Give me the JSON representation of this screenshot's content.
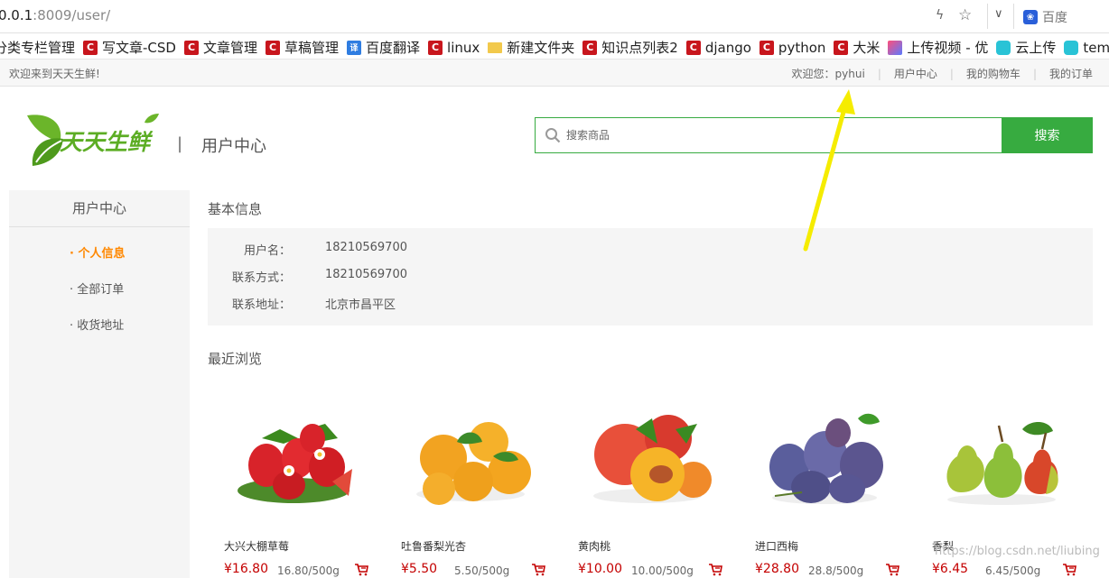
{
  "browser": {
    "url_host": "0.0.1",
    "url_rest": ":8009/user/",
    "search_engine": "百度",
    "bookmarks": [
      {
        "label": "分类专栏管理",
        "icon": "none"
      },
      {
        "label": "写文章-CSD",
        "icon": "csdn"
      },
      {
        "label": "文章管理",
        "icon": "csdn"
      },
      {
        "label": "草稿管理",
        "icon": "csdn"
      },
      {
        "label": "百度翻译",
        "icon": "translate"
      },
      {
        "label": "linux",
        "icon": "csdn"
      },
      {
        "label": "新建文件夹",
        "icon": "folder"
      },
      {
        "label": "知识点列表2",
        "icon": "csdn"
      },
      {
        "label": "django",
        "icon": "csdn"
      },
      {
        "label": "python",
        "icon": "csdn"
      },
      {
        "label": "大米",
        "icon": "csdn"
      },
      {
        "label": "上传视频 - 优",
        "icon": "video"
      },
      {
        "label": "云上传",
        "icon": "cloud"
      },
      {
        "label": "tem",
        "icon": "cloud"
      }
    ]
  },
  "topbar": {
    "welcome": "欢迎来到天天生鲜!",
    "greeting_prefix": "欢迎您：",
    "username": "pyhui",
    "links": [
      "用户中心",
      "我的购物车",
      "我的订单"
    ]
  },
  "header": {
    "logo_text": "天天生鲜",
    "separator": "|",
    "page_title": "用户中心",
    "search_placeholder": "搜索商品",
    "search_button": "搜索"
  },
  "sidebar": {
    "title": "用户中心",
    "items": [
      {
        "label": "· 个人信息",
        "active": true
      },
      {
        "label": "· 全部订单",
        "active": false
      },
      {
        "label": "· 收货地址",
        "active": false
      }
    ]
  },
  "basic_info": {
    "title": "基本信息",
    "rows": [
      {
        "key": "用户名：",
        "value": "18210569700"
      },
      {
        "key": "联系方式：",
        "value": "18210569700"
      },
      {
        "key": "联系地址：",
        "value": "北京市昌平区"
      }
    ]
  },
  "recent": {
    "title": "最近浏览",
    "goods": [
      {
        "name": "大兴大棚草莓",
        "price": "¥16.80",
        "unit": "16.80/500g",
        "fruit": "strawberry"
      },
      {
        "name": "吐鲁番梨光杏",
        "price": "¥5.50",
        "unit": "5.50/500g",
        "fruit": "apricot"
      },
      {
        "name": "黄肉桃",
        "price": "¥10.00",
        "unit": "10.00/500g",
        "fruit": "peach"
      },
      {
        "name": "进口西梅",
        "price": "¥28.80",
        "unit": "28.8/500g",
        "fruit": "plum"
      },
      {
        "name": "香梨",
        "price": "¥6.45",
        "unit": "6.45/500g",
        "fruit": "pear"
      }
    ]
  },
  "watermark": "https://blog.csdn.net/liubing",
  "colors": {
    "brand_green": "#37ab40",
    "active_orange": "#ff8800",
    "price_red": "#c40000",
    "annotation_arrow": "#f5ec00"
  }
}
